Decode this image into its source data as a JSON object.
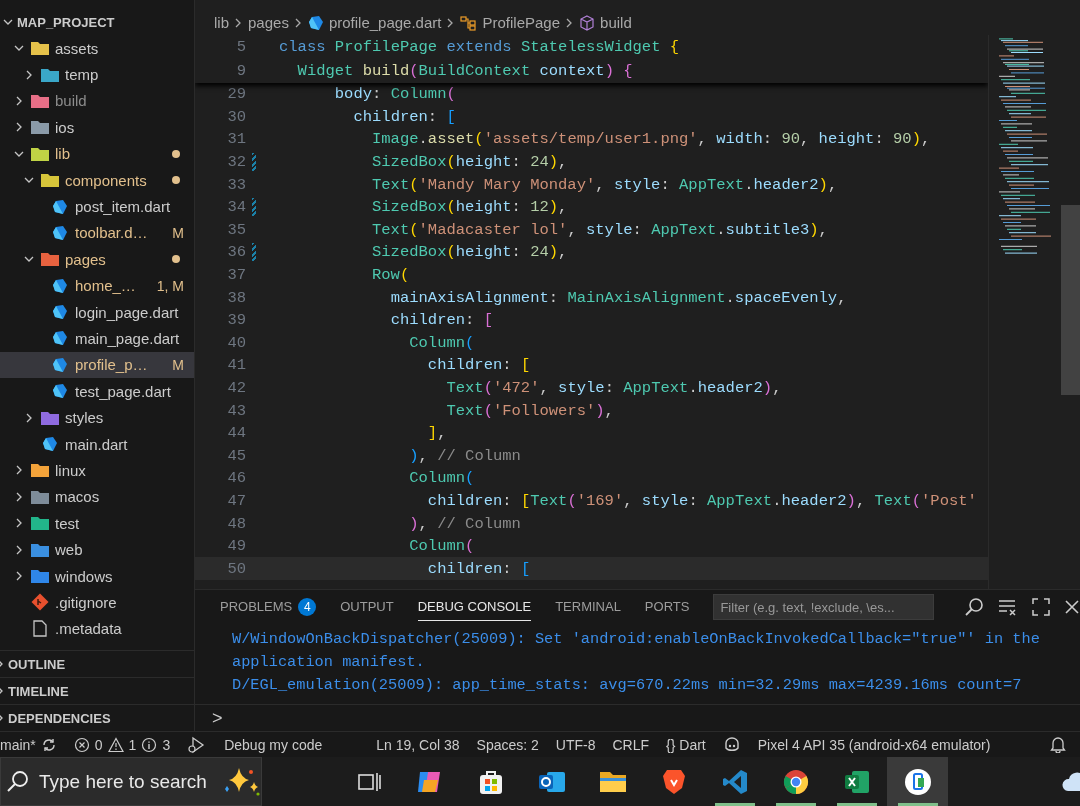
{
  "explorer": {
    "title": "MAP_PROJECT",
    "expanded": true,
    "items": [
      {
        "label": "assets",
        "kind": "folder",
        "color": "#e5c14a",
        "expanded": true,
        "selected": false,
        "modified": false,
        "ignored": false,
        "children": [
          {
            "label": "temp",
            "kind": "folder",
            "color": "#3aa7c8",
            "expanded": false,
            "selected": false,
            "modified": false,
            "ignored": false
          }
        ]
      },
      {
        "label": "build",
        "kind": "folder",
        "color": "#e76f87",
        "expanded": false,
        "selected": false,
        "modified": false,
        "ignored": true
      },
      {
        "label": "ios",
        "kind": "folder",
        "color": "#8a9aa8",
        "expanded": false,
        "selected": false,
        "modified": false,
        "ignored": false
      },
      {
        "label": "lib",
        "kind": "folder",
        "color": "#c0d345",
        "expanded": true,
        "selected": false,
        "modified": true,
        "ignored": false,
        "children": [
          {
            "label": "components",
            "kind": "folder",
            "color": "#d7c53a",
            "expanded": true,
            "selected": false,
            "modified": true,
            "ignored": false,
            "children": [
              {
                "label": "post_item.dart",
                "kind": "dart",
                "selected": false,
                "modified": false,
                "ignored": false
              },
              {
                "label": "toolbar.d…",
                "kind": "dart",
                "selected": false,
                "modified": true,
                "ignored": false,
                "badge": "M"
              }
            ]
          },
          {
            "label": "pages",
            "kind": "folder",
            "color": "#e8623f",
            "expanded": true,
            "selected": false,
            "modified": true,
            "ignored": false,
            "children": [
              {
                "label": "home_…",
                "kind": "dart",
                "selected": false,
                "modified": true,
                "ignored": false,
                "badge": "1, M"
              },
              {
                "label": "login_page.dart",
                "kind": "dart",
                "selected": false,
                "modified": false,
                "ignored": false
              },
              {
                "label": "main_page.dart",
                "kind": "dart",
                "selected": false,
                "modified": false,
                "ignored": false
              },
              {
                "label": "profile_p…",
                "kind": "dart",
                "selected": true,
                "modified": true,
                "ignored": false,
                "badge": "M"
              },
              {
                "label": "test_page.dart",
                "kind": "dart",
                "selected": false,
                "modified": false,
                "ignored": false
              }
            ]
          },
          {
            "label": "styles",
            "kind": "folder",
            "color": "#8f6be0",
            "expanded": false,
            "selected": false,
            "modified": false,
            "ignored": false
          },
          {
            "label": "main.dart",
            "kind": "dart",
            "selected": false,
            "modified": false,
            "ignored": false
          }
        ]
      },
      {
        "label": "linux",
        "kind": "folder",
        "color": "#f3a33a",
        "expanded": false,
        "selected": false,
        "modified": false,
        "ignored": false
      },
      {
        "label": "macos",
        "kind": "folder",
        "color": "#7e8c99",
        "expanded": false,
        "selected": false,
        "modified": false,
        "ignored": false
      },
      {
        "label": "test",
        "kind": "folder",
        "color": "#22b58a",
        "expanded": false,
        "selected": false,
        "modified": false,
        "ignored": false
      },
      {
        "label": "web",
        "kind": "folder",
        "color": "#3a8fe0",
        "expanded": false,
        "selected": false,
        "modified": false,
        "ignored": false
      },
      {
        "label": "windows",
        "kind": "folder",
        "color": "#2f86e8",
        "expanded": false,
        "selected": false,
        "modified": false,
        "ignored": false
      },
      {
        "label": ".gitignore",
        "kind": "git",
        "selected": false,
        "modified": false,
        "ignored": false
      },
      {
        "label": ".metadata",
        "kind": "doc",
        "selected": false,
        "modified": false,
        "ignored": false
      }
    ]
  },
  "sections": [
    {
      "label": "OUTLINE",
      "expanded": false
    },
    {
      "label": "TIMELINE",
      "expanded": false
    },
    {
      "label": "DEPENDENCIES",
      "expanded": false
    }
  ],
  "breadcrumb": [
    {
      "label": "lib",
      "kind": "folder"
    },
    {
      "label": "pages",
      "kind": "folder"
    },
    {
      "label": "profile_page.dart",
      "kind": "file"
    },
    {
      "label": "ProfilePage",
      "kind": "class"
    },
    {
      "label": "build",
      "kind": "method"
    }
  ],
  "editor": {
    "sticky_lines": [
      {
        "number": "5",
        "code": "class ProfilePage extends StatelessWidget {"
      },
      {
        "number": "9",
        "code": "  Widget build(BuildContext context) {"
      }
    ],
    "lines": [
      {
        "number": "29",
        "changed": false,
        "current": false,
        "code": "      body: Column("
      },
      {
        "number": "30",
        "changed": false,
        "current": false,
        "code": "        children: ["
      },
      {
        "number": "31",
        "changed": false,
        "current": false,
        "code": "          Image.asset('assets/temp/user1.png', width: 90, height: 90),"
      },
      {
        "number": "32",
        "changed": true,
        "current": false,
        "code": "          SizedBox(height: 24),"
      },
      {
        "number": "33",
        "changed": false,
        "current": false,
        "code": "          Text('Mandy Mary Monday', style: AppText.header2),"
      },
      {
        "number": "34",
        "changed": true,
        "current": false,
        "code": "          SizedBox(height: 12),"
      },
      {
        "number": "35",
        "changed": false,
        "current": false,
        "code": "          Text('Madacaster lol', style: AppText.subtitle3),"
      },
      {
        "number": "36",
        "changed": true,
        "current": false,
        "code": "          SizedBox(height: 24),"
      },
      {
        "number": "37",
        "changed": false,
        "current": false,
        "code": "          Row("
      },
      {
        "number": "38",
        "changed": false,
        "current": false,
        "code": "            mainAxisAlignment: MainAxisAlignment.spaceEvenly,"
      },
      {
        "number": "39",
        "changed": false,
        "current": false,
        "code": "            children: ["
      },
      {
        "number": "40",
        "changed": false,
        "current": false,
        "code": "              Column("
      },
      {
        "number": "41",
        "changed": false,
        "current": false,
        "code": "                children: ["
      },
      {
        "number": "42",
        "changed": false,
        "current": false,
        "code": "                  Text('472', style: AppText.header2),"
      },
      {
        "number": "43",
        "changed": false,
        "current": false,
        "code": "                  Text('Followers'),"
      },
      {
        "number": "44",
        "changed": false,
        "current": false,
        "code": "                ],"
      },
      {
        "number": "45",
        "changed": false,
        "current": false,
        "code": "              ), // Column"
      },
      {
        "number": "46",
        "changed": false,
        "current": false,
        "code": "              Column("
      },
      {
        "number": "47",
        "changed": false,
        "current": false,
        "code": "                children: [Text('169', style: AppText.header2), Text('Post'"
      },
      {
        "number": "48",
        "changed": false,
        "current": false,
        "code": "              ), // Column"
      },
      {
        "number": "49",
        "changed": false,
        "current": false,
        "code": "              Column("
      },
      {
        "number": "50",
        "changed": false,
        "current": true,
        "code": "                children: ["
      }
    ]
  },
  "panel": {
    "tabs": [
      {
        "label": "PROBLEMS",
        "badge": "4",
        "selected": false
      },
      {
        "label": "OUTPUT",
        "selected": false
      },
      {
        "label": "DEBUG CONSOLE",
        "selected": true
      },
      {
        "label": "TERMINAL",
        "selected": false
      },
      {
        "label": "PORTS",
        "selected": false
      }
    ],
    "filter": {
      "placeholder": "Filter (e.g. text, !exclude, \\es..."
    },
    "output": [
      "W/WindowOnBackDispatcher(25009): Set 'android:enableOnBackInvokedCallback=\"true\"' in the application manifest.",
      "D/EGL_emulation(25009): app_time_stats: avg=670.22ms min=32.29ms max=4239.16ms count=7"
    ],
    "prompt": ">"
  },
  "status_bar": {
    "branch": "main*",
    "errors": "0",
    "warnings": "1",
    "infos": "3",
    "debug": "Debug my code",
    "items": [
      "Ln 19, Col 38",
      "Spaces: 2",
      "UTF-8",
      "CRLF"
    ],
    "language": {
      "braces": "{}",
      "label": "Dart"
    },
    "device": "Pixel 4 API 35 (android-x64 emulator)"
  },
  "taskbar": {
    "search": {
      "placeholder": "Type here to search"
    },
    "apps": [
      {
        "kind": "task-view",
        "running": false,
        "selected": false
      },
      {
        "kind": "copilot",
        "running": false,
        "selected": false
      },
      {
        "kind": "store",
        "running": false,
        "selected": false
      },
      {
        "kind": "outlook",
        "running": false,
        "selected": false
      },
      {
        "kind": "explorer",
        "running": false,
        "selected": false
      },
      {
        "kind": "brave",
        "running": false,
        "selected": false
      },
      {
        "kind": "vscode",
        "running": true,
        "selected": false
      },
      {
        "kind": "chrome",
        "running": true,
        "selected": false
      },
      {
        "kind": "excel",
        "running": true,
        "selected": false
      },
      {
        "kind": "phone",
        "running": true,
        "selected": true
      }
    ]
  }
}
